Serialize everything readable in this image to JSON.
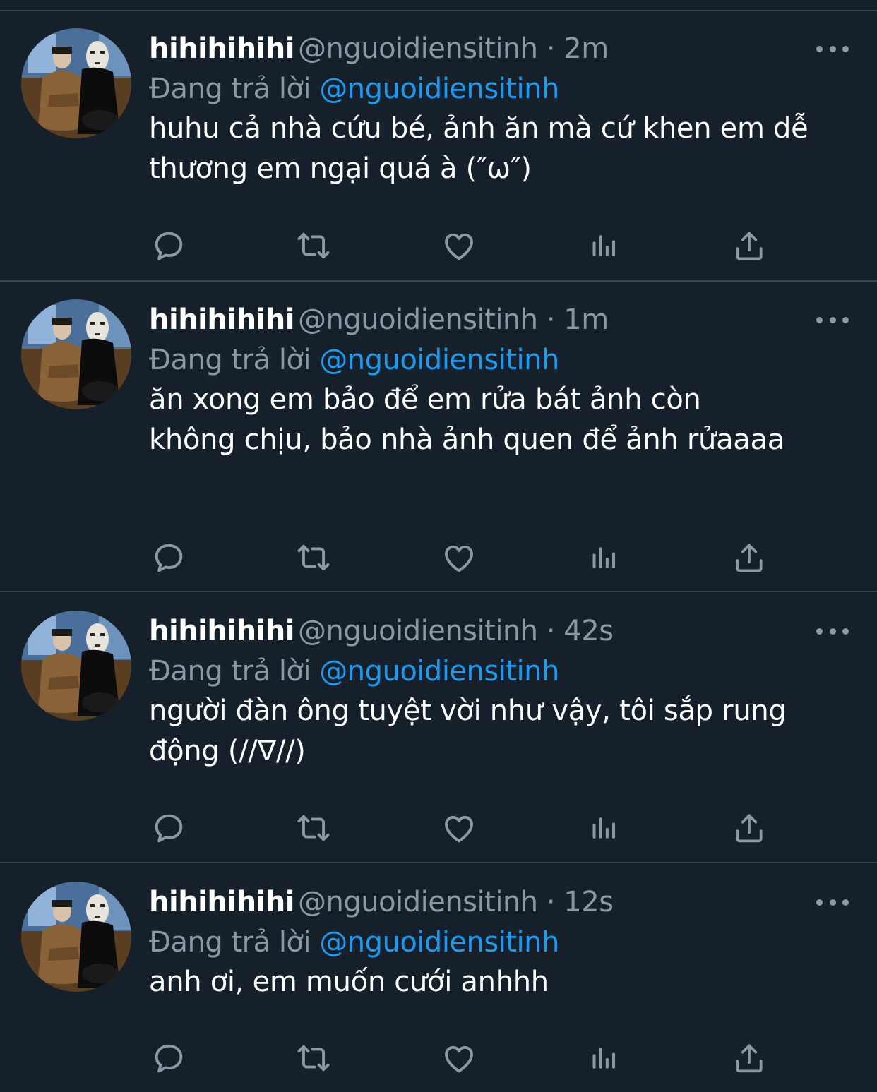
{
  "theme": {
    "background": "#15202b",
    "divider": "#38444d",
    "muted": "#8b98a5",
    "accent": "#1d9bf0",
    "text": "#ffffff"
  },
  "icons": {
    "reply": "reply-icon",
    "retweet": "retweet-icon",
    "like": "heart-icon",
    "views": "bar-chart-icon",
    "share": "share-icon",
    "more": "more-icon"
  },
  "tweets": [
    {
      "name": "hihihihihi",
      "handle": "@nguoidiensitinh",
      "time": "2m",
      "reply_label": "Đang trả lời",
      "reply_to": "@nguoidiensitinh",
      "text": "huhu cả nhà cứu bé, ảnh ăn mà cứ khen em dễ thương em ngại quá à (″ω″)"
    },
    {
      "name": "hihihihihi",
      "handle": "@nguoidiensitinh",
      "time": "1m",
      "reply_label": "Đang trả lời",
      "reply_to": "@nguoidiensitinh",
      "text": "ăn xong em bảo để em rửa bát ảnh còn không chịu, bảo nhà ảnh quen để ảnh rửaaaa"
    },
    {
      "name": "hihihihihi",
      "handle": "@nguoidiensitinh",
      "time": "42s",
      "reply_label": "Đang trả lời",
      "reply_to": "@nguoidiensitinh",
      "text": "người đàn ông tuyệt vời như vậy, tôi sắp rung động (//∇//)"
    },
    {
      "name": "hihihihihi",
      "handle": "@nguoidiensitinh",
      "time": "12s",
      "reply_label": "Đang trả lời",
      "reply_to": "@nguoidiensitinh",
      "text": "anh ơi, em muốn cưới anhhh"
    }
  ]
}
